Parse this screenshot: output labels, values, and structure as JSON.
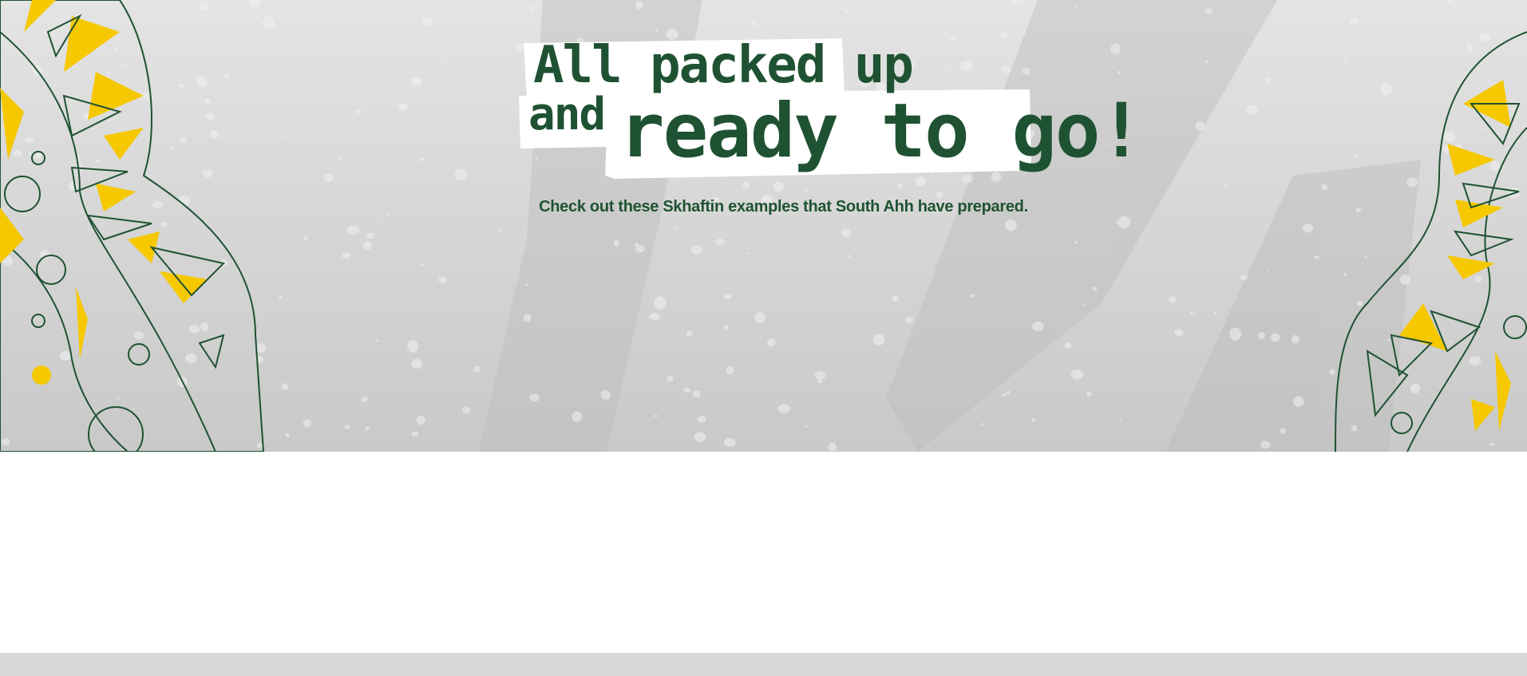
{
  "hero": {
    "title_line_1": "All packed up",
    "title_line_2": "and",
    "title_line_3": "ready to go!",
    "subtitle": "Check out these Skhaftin examples that South Ahh have prepared.",
    "background_image": "water-droplets-on-glass",
    "decoration_left": "green-yellow-tribal-pattern",
    "decoration_right": "green-yellow-tribal-pattern"
  },
  "colors": {
    "brand_green": "#1f5232",
    "accent_yellow": "#f5c800",
    "hero_bg": "#d6d6d6",
    "footer_bg": "#d8d8d8",
    "label_bg": "#ffffff"
  }
}
